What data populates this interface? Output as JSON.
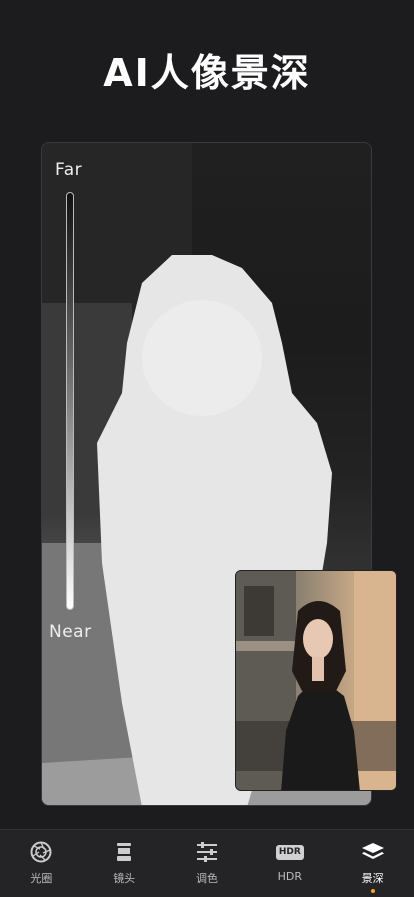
{
  "header": {
    "title": "AI人像景深"
  },
  "depth_map": {
    "far_label": "Far",
    "near_label": "Near"
  },
  "tabs": [
    {
      "label": "光圈",
      "icon": "aperture-icon"
    },
    {
      "label": "镜头",
      "icon": "lens-icon"
    },
    {
      "label": "调色",
      "icon": "sliders-icon"
    },
    {
      "label": "HDR",
      "icon": "hdr-icon",
      "badge": "HDR"
    },
    {
      "label": "景深",
      "icon": "layers-icon",
      "active": true
    }
  ],
  "colors": {
    "background": "#1c1c1e",
    "tabbar": "#242426",
    "active_dot": "#f5a623"
  }
}
